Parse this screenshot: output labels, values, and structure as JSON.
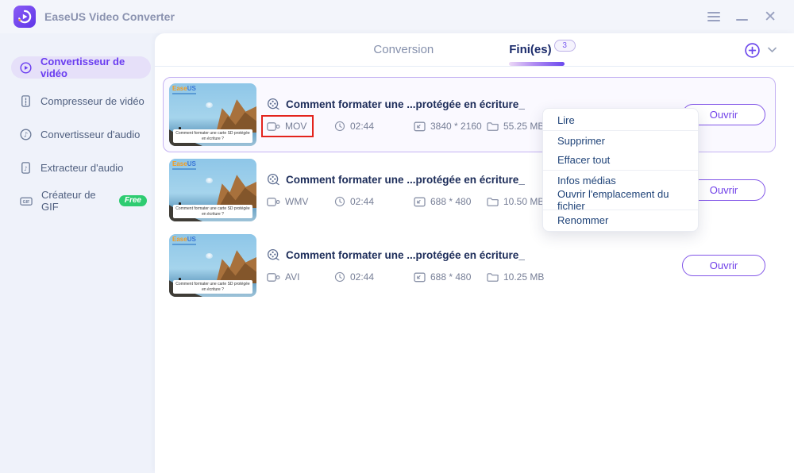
{
  "titlebar": {
    "app_title": "EaseUS Video Converter"
  },
  "sidebar": {
    "items": [
      {
        "label": "Convertisseur de vidéo",
        "active": true
      },
      {
        "label": "Compresseur de vidéo"
      },
      {
        "label": "Convertisseur d'audio"
      },
      {
        "label": "Extracteur d'audio"
      },
      {
        "label": "Créateur de GIF",
        "badge": "Free"
      }
    ]
  },
  "header": {
    "tab_conversion": "Conversion",
    "tab_finished": "Fini(es)",
    "finished_count": "3"
  },
  "rows": [
    {
      "title": "Comment formater une ...protégée en écriture_",
      "format": "MOV",
      "duration": "02:44",
      "resolution": "3840 * 2160",
      "size": "55.25 MB",
      "open_label": "Ouvrir",
      "thumb": {
        "brand_orange": "Ease",
        "brand_blue": "US",
        "caption": "Comment formater une carte SD protégée en écriture ?"
      }
    },
    {
      "title": "Comment formater une ...protégée en écriture_",
      "format": "WMV",
      "duration": "02:44",
      "resolution": "688 * 480",
      "size": "10.50 MB",
      "open_label": "Ouvrir",
      "thumb": {
        "brand_orange": "Ease",
        "brand_blue": "US",
        "caption": "Comment formater une carte SD protégée en écriture ?"
      }
    },
    {
      "title": "Comment formater une ...protégée en écriture_",
      "format": "AVI",
      "duration": "02:44",
      "resolution": "688 * 480",
      "size": "10.25 MB",
      "open_label": "Ouvrir",
      "thumb": {
        "brand_orange": "Ease",
        "brand_blue": "US",
        "caption": "Comment formater une carte SD protégée en écriture ?"
      }
    }
  ],
  "context_menu": {
    "items": [
      "Lire",
      "Supprimer",
      "Effacer tout",
      "Infos médias",
      "Ouvrir l'emplacement du fichier",
      "Renommer"
    ]
  },
  "colors": {
    "accent_purple": "#6a3df0",
    "navy_text": "#1c2c59",
    "menu_text": "#1f4378",
    "meta_gray": "#767e96",
    "highlight_red": "#e3241d",
    "free_badge_green": "#2ecc71",
    "selected_row_border": "#c4b2f2"
  }
}
